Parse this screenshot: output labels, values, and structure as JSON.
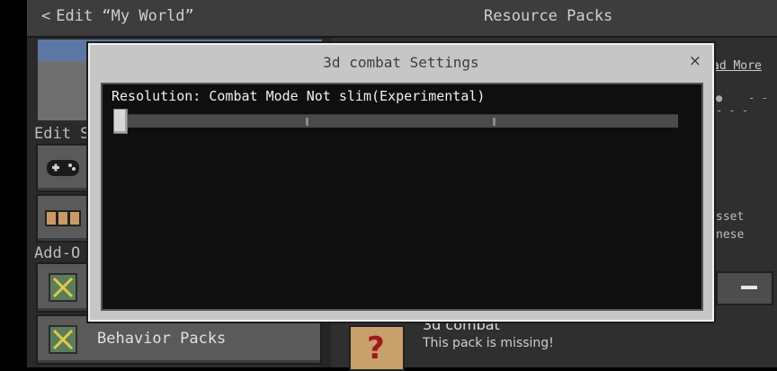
{
  "header": {
    "back_label": "Edit “My World”",
    "back_icon": "chevron-left-icon",
    "right_title": "Resource Packs"
  },
  "sidebar": {
    "edit_settings_label": "Edit Se",
    "addons_label": "Add-O",
    "behavior_packs_label": "Behavior Packs"
  },
  "right_panel": {
    "read_more": "ad More",
    "asset_text_1": "sset",
    "asset_text_2": "nese",
    "pack_name": "3d combat",
    "pack_status": "This pack is missing!",
    "missing_icon_glyph": "?"
  },
  "dialog": {
    "title": "3d combat Settings",
    "close_glyph": "×",
    "setting_label": "Resolution: Combat Mode Not slim(Experimental)",
    "slider_value": 0,
    "slider_ticks": [
      0,
      0.333,
      0.667
    ]
  }
}
